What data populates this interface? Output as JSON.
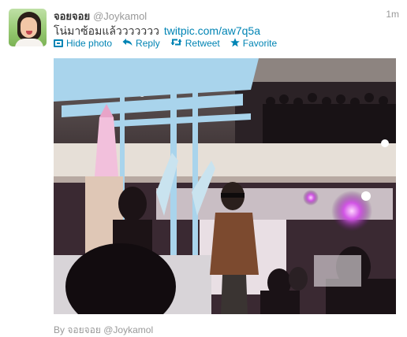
{
  "tweet": {
    "author": {
      "fullname": "จอยจอย",
      "screen_name": "@Joykamol"
    },
    "timestamp": "1m",
    "text": "โน่มาซ้อมแล้ววววววว",
    "link": "twitpic.com/aw7q5a"
  },
  "actions": {
    "hide_photo": "Hide photo",
    "reply": "Reply",
    "retweet": "Retweet",
    "favorite": "Favorite"
  },
  "icons": {
    "hide_photo": "photo-icon",
    "reply": "reply-arrow-icon",
    "retweet": "retweet-icon",
    "favorite": "star-icon"
  },
  "attribution": {
    "by": "By",
    "fullname": "จอยจอย",
    "screen_name": "@Joykamol"
  },
  "colors": {
    "link": "#0084b4",
    "muted": "#999999",
    "text": "#333333"
  }
}
